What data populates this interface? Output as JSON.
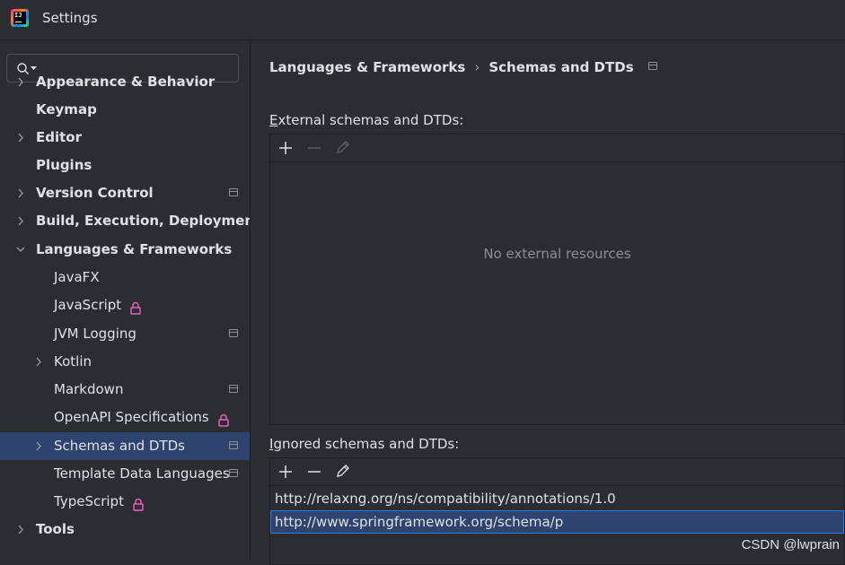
{
  "window": {
    "title": "Settings",
    "app_icon": "intellij-idea-icon",
    "app_icon_text": "IJ"
  },
  "search": {
    "value": "",
    "icon": "search-icon"
  },
  "sidebar": {
    "items": [
      {
        "label": "Appearance & Behavior",
        "expandable": true,
        "expanded": false,
        "bold": true
      },
      {
        "label": "Keymap",
        "bold": true
      },
      {
        "label": "Editor",
        "expandable": true,
        "expanded": false,
        "bold": true
      },
      {
        "label": "Plugins",
        "bold": true
      },
      {
        "label": "Version Control",
        "expandable": true,
        "expanded": false,
        "bold": true,
        "project_icon": true
      },
      {
        "label": "Build, Execution, Deployment",
        "expandable": true,
        "expanded": false,
        "bold": true
      },
      {
        "label": "Languages & Frameworks",
        "expandable": true,
        "expanded": true,
        "bold": true
      },
      {
        "label": "JavaFX"
      },
      {
        "label": "JavaScript",
        "lock_icon": true
      },
      {
        "label": "JVM Logging",
        "project_icon": true
      },
      {
        "label": "Kotlin",
        "expandable": true,
        "expanded": false
      },
      {
        "label": "Markdown",
        "project_icon": true
      },
      {
        "label": "OpenAPI Specifications",
        "lock_icon": true
      },
      {
        "label": "Schemas and DTDs",
        "expandable": true,
        "expanded": false,
        "selected": true,
        "project_icon": true
      },
      {
        "label": "Template Data Languages",
        "project_icon": true
      },
      {
        "label": "TypeScript",
        "lock_icon": true
      },
      {
        "label": "Tools",
        "expandable": true,
        "expanded": false,
        "bold": true
      }
    ]
  },
  "breadcrumb": {
    "parent": "Languages & Frameworks",
    "separator": "›",
    "current": "Schemas and DTDs"
  },
  "external": {
    "label_mnemonic": "E",
    "label_rest": "xternal schemas and DTDs:",
    "empty_text": "No external resources",
    "toolbar": {
      "add_enabled": true,
      "remove_enabled": false,
      "edit_enabled": false
    }
  },
  "ignored": {
    "label_mnemonic": "I",
    "label_rest": "gnored schemas and DTDs:",
    "toolbar": {
      "add_enabled": true,
      "remove_enabled": true,
      "edit_enabled": true
    },
    "rows": [
      "http://relaxng.org/ns/compatibility/annotations/1.0",
      "http://www.springframework.org/schema/p"
    ],
    "selected_row": 1
  },
  "watermark": "CSDN @lwprain",
  "colors": {
    "background": "#2b2d30",
    "selection": "#2e436e",
    "selection_border": "#3574f0",
    "text": "#dfe1e5",
    "muted": "#8c8f95",
    "lock": "#e860c5"
  }
}
